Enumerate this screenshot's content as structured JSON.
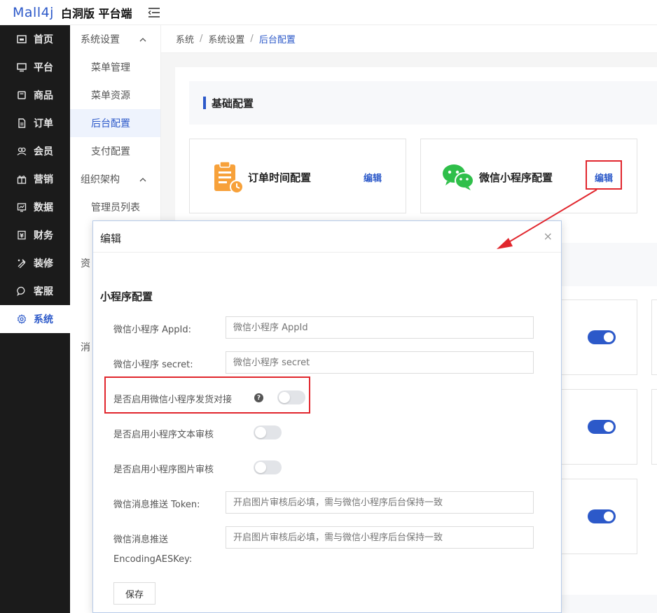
{
  "app": {
    "logo_mark": "Mall4j",
    "title": "白洞版 平台端"
  },
  "sidebar": {
    "items": [
      {
        "label": "首页",
        "icon": "home-icon"
      },
      {
        "label": "平台",
        "icon": "monitor-icon"
      },
      {
        "label": "商品",
        "icon": "goods-icon"
      },
      {
        "label": "订单",
        "icon": "order-icon"
      },
      {
        "label": "会员",
        "icon": "member-icon"
      },
      {
        "label": "营销",
        "icon": "gift-icon"
      },
      {
        "label": "数据",
        "icon": "chart-icon"
      },
      {
        "label": "财务",
        "icon": "finance-icon"
      },
      {
        "label": "装修",
        "icon": "decorate-icon"
      },
      {
        "label": "客服",
        "icon": "chat-icon"
      },
      {
        "label": "系统",
        "icon": "gear-icon"
      }
    ],
    "active": "系统"
  },
  "subsidebar": {
    "group1": "系统设置",
    "items1": [
      "菜单管理",
      "菜单资源",
      "后台配置",
      "支付配置"
    ],
    "group2": "组织架构",
    "items2": [
      "管理员列表"
    ],
    "cut_items": [
      "资",
      "消"
    ]
  },
  "breadcrumb": {
    "items": [
      "系统",
      "系统设置",
      "后台配置"
    ],
    "separator": "/"
  },
  "section": {
    "title": "基础配置"
  },
  "cards": {
    "order_time": {
      "title": "订单时间配置",
      "action": "编辑"
    },
    "wechat_mini": {
      "title": "微信小程序配置",
      "action": "编辑"
    }
  },
  "background_toggles": [
    true,
    true,
    true
  ],
  "dialog": {
    "title": "编辑",
    "close_glyph": "×",
    "section_title": "小程序配置",
    "fields": {
      "appid_label": "微信小程序 AppId:",
      "appid_placeholder": "微信小程序 AppId",
      "secret_label": "微信小程序 secret:",
      "secret_placeholder": "微信小程序 secret",
      "shipping_label": "是否启用微信小程序发货对接",
      "shipping_enabled": false,
      "text_audit_label": "是否启用小程序文本审核",
      "text_audit_enabled": false,
      "image_audit_label": "是否启用小程序图片审核",
      "image_audit_enabled": false,
      "token_label": "微信消息推送 Token:",
      "token_placeholder": "开启图片审核后必填，需与微信小程序后台保持一致",
      "aes_label_line1": "微信消息推送",
      "aes_label_line2": "EncodingAESKey:",
      "aes_placeholder": "开启图片审核后必填，需与微信小程序后台保持一致"
    },
    "save_label": "保存",
    "help_glyph": "?"
  },
  "colors": {
    "brand": "#2c59c9",
    "annotation": "#e1262d",
    "order_icon": "#f7a13a",
    "wechat_icon": "#2fbf4a"
  }
}
